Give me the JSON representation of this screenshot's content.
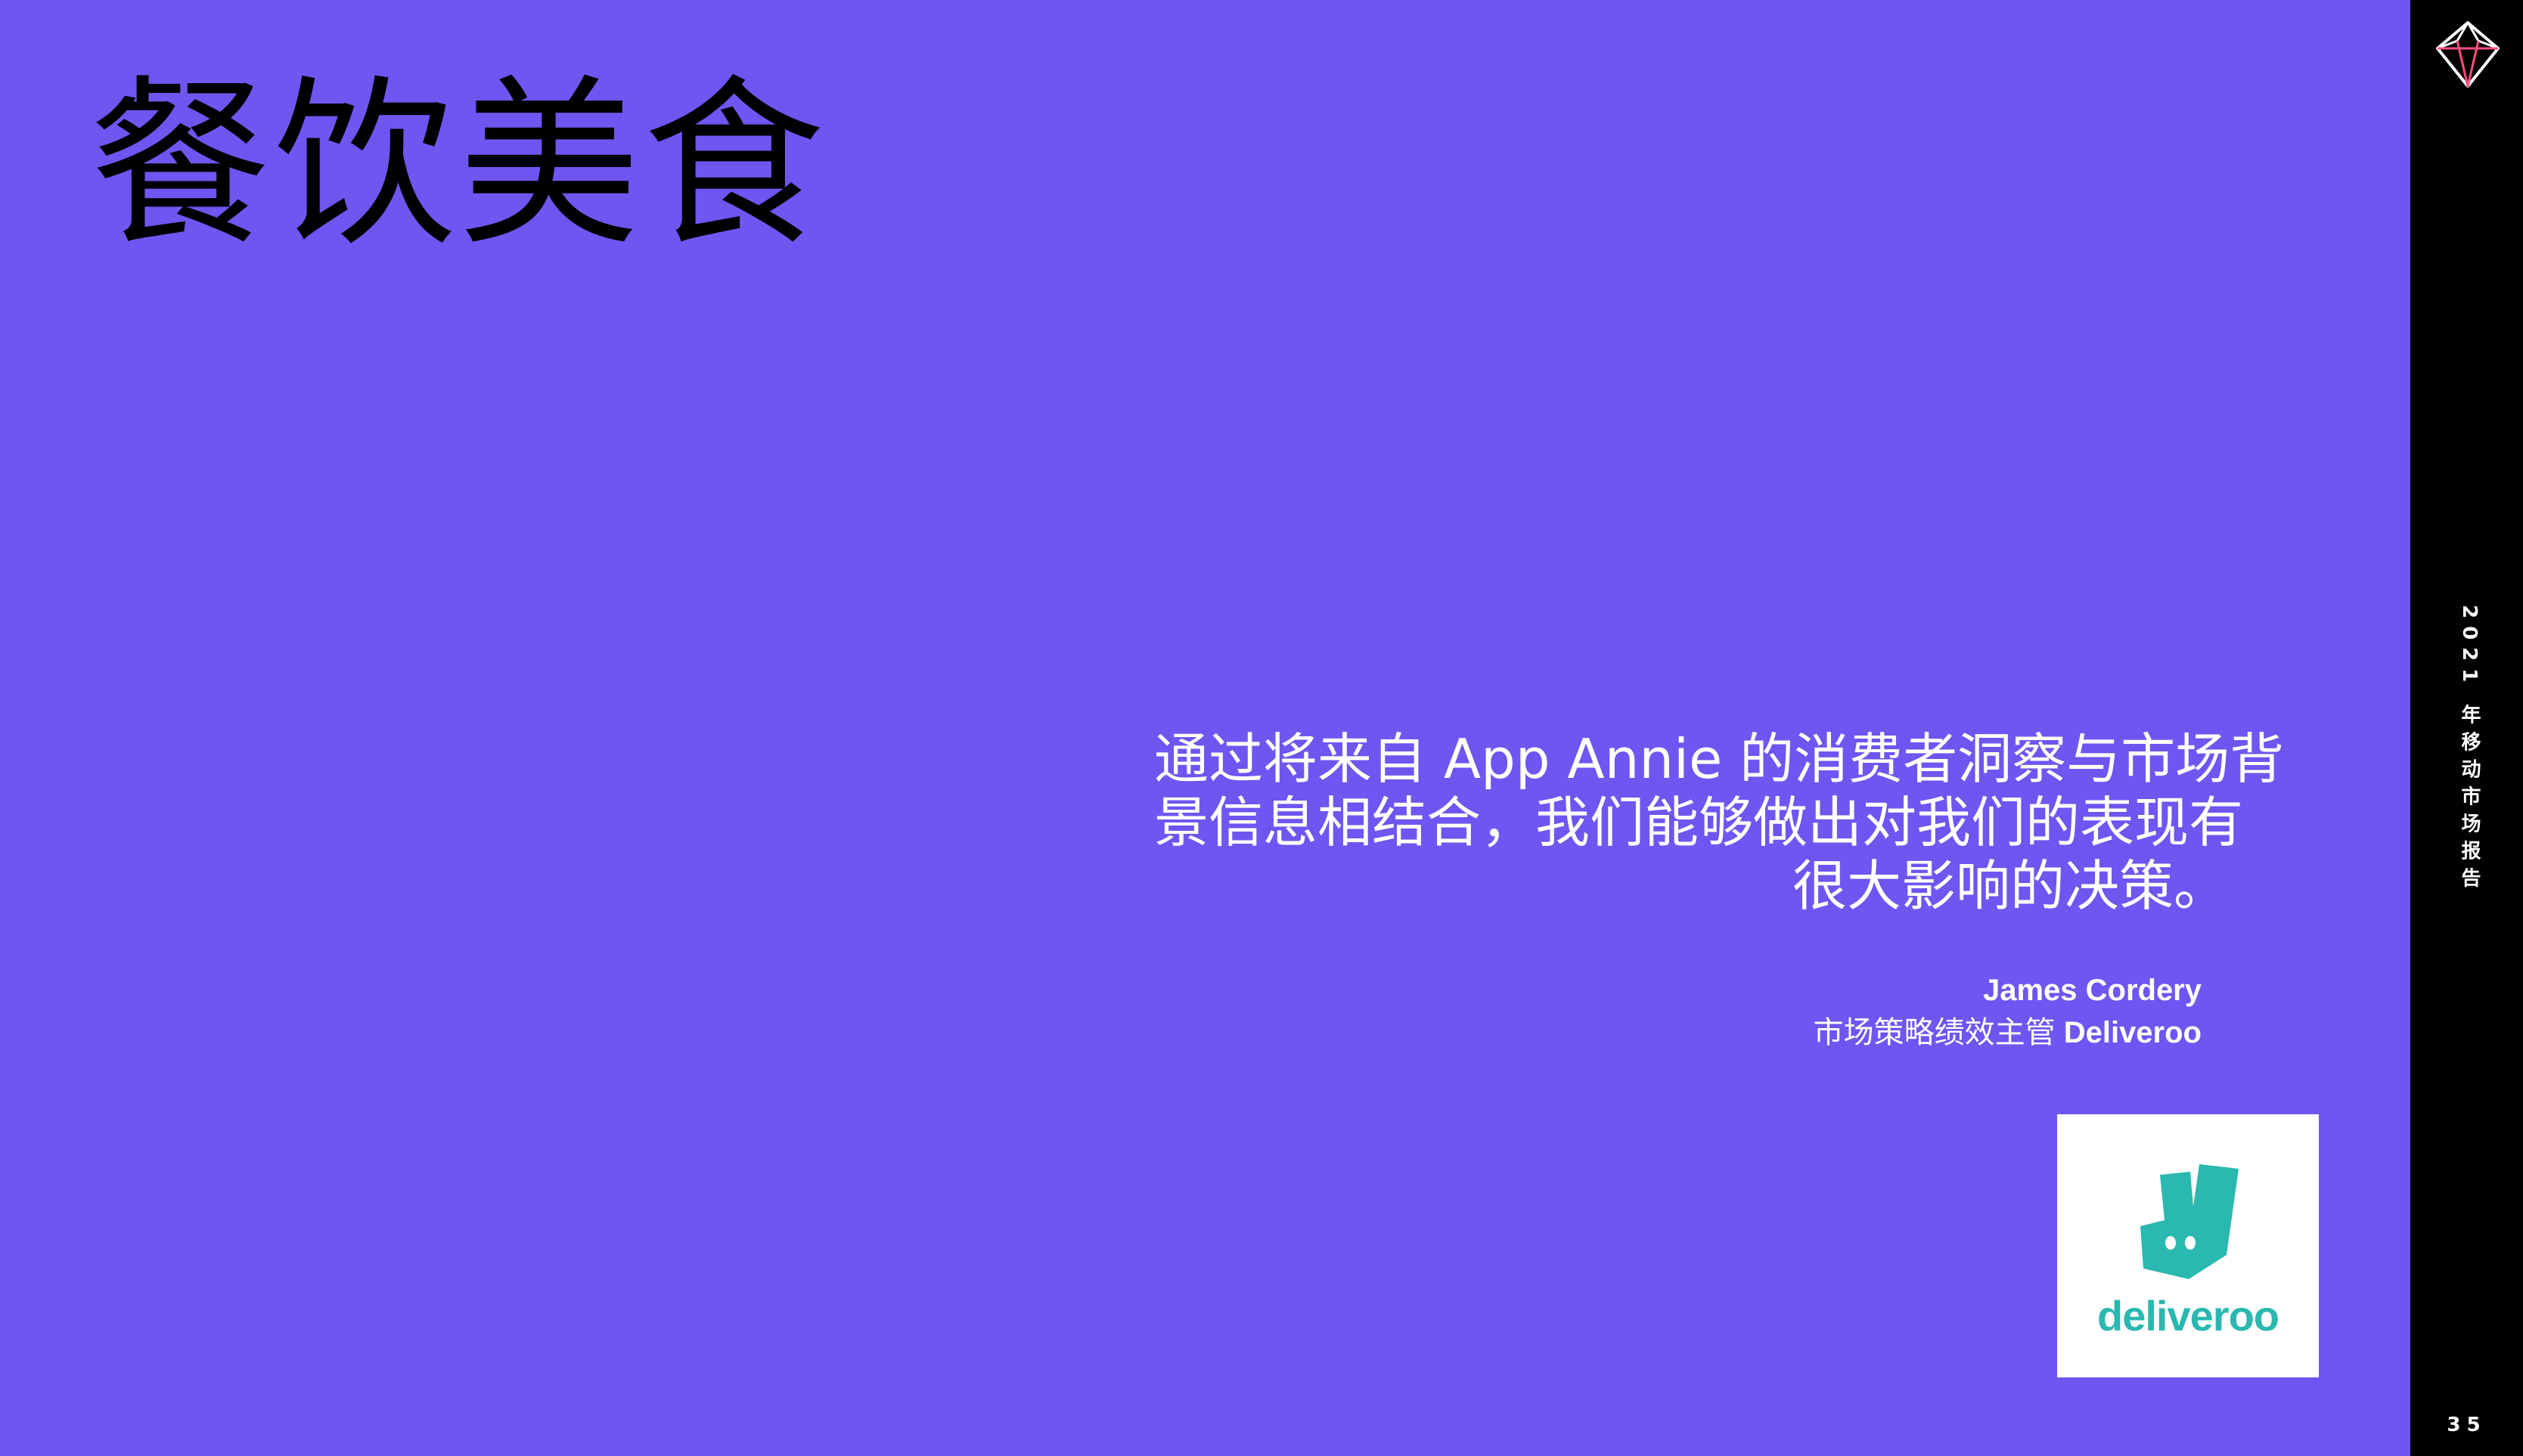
{
  "slide": {
    "title": "餐饮美食",
    "background_color": "#7055f1"
  },
  "quote": {
    "lines": [
      "通过将来自 App Annie 的消费者洞察与市场背",
      "景信息相结合，我们能够做出对我们的表现有",
      "很大影响的决策。"
    ]
  },
  "attribution": {
    "name": "James Cordery",
    "role": "市场策略绩效主管",
    "company": "Deliveroo"
  },
  "logo": {
    "icon": "deliveroo-kangaroo-icon",
    "text": "deliveroo",
    "color": "#2ab8b0"
  },
  "sidebar": {
    "brand_icon": "diamond-icon",
    "label": "2021 年移动市场报告",
    "page_number": "35"
  }
}
